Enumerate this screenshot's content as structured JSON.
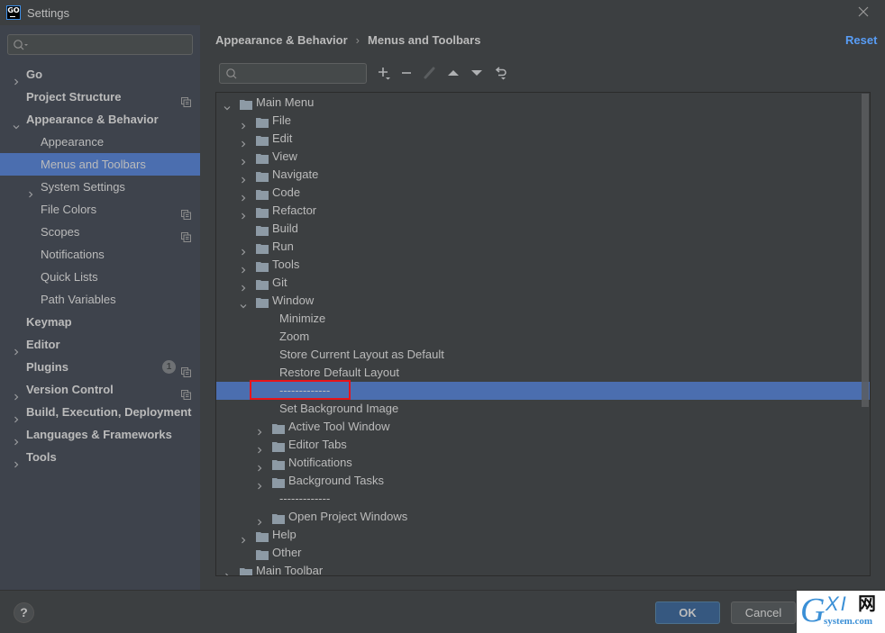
{
  "window": {
    "app_logo": "GO",
    "title": "Settings",
    "close_icon": "close-icon"
  },
  "sidebar": {
    "search_placeholder": "",
    "items": [
      {
        "label": "Go",
        "level": 0,
        "bold": true,
        "chevron": "right"
      },
      {
        "label": "Project Structure",
        "level": 0,
        "bold": true,
        "chevron": null,
        "project_icon": true
      },
      {
        "label": "Appearance & Behavior",
        "level": 0,
        "bold": true,
        "chevron": "down"
      },
      {
        "label": "Appearance",
        "level": 1,
        "bold": false,
        "chevron": null
      },
      {
        "label": "Menus and Toolbars",
        "level": 1,
        "bold": false,
        "chevron": null,
        "selected": true
      },
      {
        "label": "System Settings",
        "level": 1,
        "bold": false,
        "chevron": "right"
      },
      {
        "label": "File Colors",
        "level": 1,
        "bold": false,
        "chevron": null,
        "project_icon": true
      },
      {
        "label": "Scopes",
        "level": 1,
        "bold": false,
        "chevron": null,
        "project_icon": true
      },
      {
        "label": "Notifications",
        "level": 1,
        "bold": false,
        "chevron": null
      },
      {
        "label": "Quick Lists",
        "level": 1,
        "bold": false,
        "chevron": null
      },
      {
        "label": "Path Variables",
        "level": 1,
        "bold": false,
        "chevron": null
      },
      {
        "label": "Keymap",
        "level": 0,
        "bold": true,
        "chevron": null
      },
      {
        "label": "Editor",
        "level": 0,
        "bold": true,
        "chevron": "right"
      },
      {
        "label": "Plugins",
        "level": 0,
        "bold": true,
        "chevron": null,
        "badge": "1",
        "project_icon": true
      },
      {
        "label": "Version Control",
        "level": 0,
        "bold": true,
        "chevron": "right",
        "project_icon": true
      },
      {
        "label": "Build, Execution, Deployment",
        "level": 0,
        "bold": true,
        "chevron": "right"
      },
      {
        "label": "Languages & Frameworks",
        "level": 0,
        "bold": true,
        "chevron": "right"
      },
      {
        "label": "Tools",
        "level": 0,
        "bold": true,
        "chevron": "right"
      }
    ]
  },
  "header": {
    "breadcrumb": [
      "Appearance & Behavior",
      "Menus and Toolbars"
    ],
    "breadcrumb_separator": "›",
    "reset_label": "Reset"
  },
  "toolbar": {
    "search_placeholder": "",
    "buttons": [
      {
        "name": "add-button",
        "icon": "plus-icon",
        "enabled": true
      },
      {
        "name": "remove-button",
        "icon": "minus-icon",
        "enabled": true
      },
      {
        "name": "edit-button",
        "icon": "pencil-icon",
        "enabled": false
      },
      {
        "name": "move-up-button",
        "icon": "arrow-up-icon",
        "enabled": true
      },
      {
        "name": "move-down-button",
        "icon": "arrow-down-icon",
        "enabled": true
      },
      {
        "name": "restore-button",
        "icon": "revert-icon",
        "enabled": true
      }
    ]
  },
  "tree": {
    "rows": [
      {
        "label": "Main Menu",
        "depth": 0,
        "chevron": "down",
        "folder": true
      },
      {
        "label": "File",
        "depth": 1,
        "chevron": "right",
        "folder": true
      },
      {
        "label": "Edit",
        "depth": 1,
        "chevron": "right",
        "folder": true
      },
      {
        "label": "View",
        "depth": 1,
        "chevron": "right",
        "folder": true
      },
      {
        "label": "Navigate",
        "depth": 1,
        "chevron": "right",
        "folder": true
      },
      {
        "label": "Code",
        "depth": 1,
        "chevron": "right",
        "folder": true
      },
      {
        "label": "Refactor",
        "depth": 1,
        "chevron": "right",
        "folder": true
      },
      {
        "label": "Build",
        "depth": 1,
        "chevron": null,
        "folder": true
      },
      {
        "label": "Run",
        "depth": 1,
        "chevron": "right",
        "folder": true
      },
      {
        "label": "Tools",
        "depth": 1,
        "chevron": "right",
        "folder": true
      },
      {
        "label": "Git",
        "depth": 1,
        "chevron": "right",
        "folder": true
      },
      {
        "label": "Window",
        "depth": 1,
        "chevron": "down",
        "folder": true
      },
      {
        "label": "Minimize",
        "depth": 2,
        "chevron": null,
        "folder": false
      },
      {
        "label": "Zoom",
        "depth": 2,
        "chevron": null,
        "folder": false
      },
      {
        "label": "Store Current Layout as Default",
        "depth": 2,
        "chevron": null,
        "folder": false
      },
      {
        "label": "Restore Default Layout",
        "depth": 2,
        "chevron": null,
        "folder": false
      },
      {
        "label": "-------------",
        "depth": 2,
        "chevron": null,
        "folder": false,
        "selected": true,
        "highlighted": true
      },
      {
        "label": "Set Background Image",
        "depth": 2,
        "chevron": null,
        "folder": false
      },
      {
        "label": "Active Tool Window",
        "depth": 2,
        "chevron": "right",
        "folder": true
      },
      {
        "label": "Editor Tabs",
        "depth": 2,
        "chevron": "right",
        "folder": true
      },
      {
        "label": "Notifications",
        "depth": 2,
        "chevron": "right",
        "folder": true
      },
      {
        "label": "Background Tasks",
        "depth": 2,
        "chevron": "right",
        "folder": true
      },
      {
        "label": "-------------",
        "depth": 2,
        "chevron": null,
        "folder": false
      },
      {
        "label": "Open Project Windows",
        "depth": 2,
        "chevron": "right",
        "folder": true
      },
      {
        "label": "Help",
        "depth": 1,
        "chevron": "right",
        "folder": true
      },
      {
        "label": "Other",
        "depth": 1,
        "chevron": null,
        "folder": true
      },
      {
        "label": "Main Toolbar",
        "depth": 0,
        "chevron": "right",
        "folder": true
      }
    ]
  },
  "footer": {
    "help_label": "?",
    "ok_label": "OK",
    "cancel_label": "Cancel"
  },
  "watermark": {
    "g": "G",
    "xi": "XI",
    "cn": "网",
    "domain": "system.com"
  },
  "colors": {
    "accent": "#4b6eaf",
    "link": "#589df6",
    "highlight_box": "#e8141a",
    "background": "#3c3f41",
    "sidebar": "#3e434c"
  }
}
